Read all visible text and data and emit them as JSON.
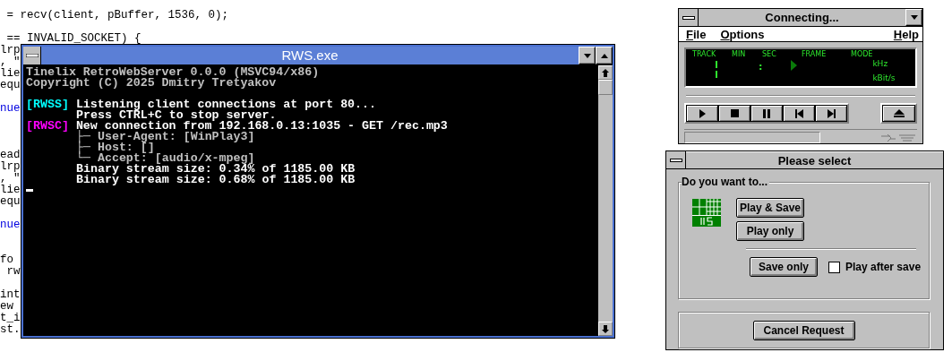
{
  "editor": {
    "lines": [
      {
        "kind": "code",
        "text": " = recv(client, pBuffer, 1536, 0);"
      },
      {
        "kind": "blank"
      },
      {
        "kind": "code",
        "text": " == INVALID_SOCKET) {"
      },
      {
        "kind": "code",
        "text": "lrp"
      },
      {
        "kind": "code",
        "text": ", \""
      },
      {
        "kind": "code",
        "text": "lie"
      },
      {
        "kind": "code",
        "text": "equ"
      },
      {
        "kind": "blank"
      },
      {
        "kind": "keyword",
        "text": "nue"
      },
      {
        "kind": "blank"
      },
      {
        "kind": "blank"
      },
      {
        "kind": "blank"
      },
      {
        "kind": "code",
        "text": "ead"
      },
      {
        "kind": "code",
        "text": "lrp"
      },
      {
        "kind": "code",
        "text": ", \""
      },
      {
        "kind": "code",
        "text": "lie"
      },
      {
        "kind": "code",
        "text": "equ"
      },
      {
        "kind": "blank"
      },
      {
        "kind": "keyword",
        "text": "nue"
      },
      {
        "kind": "blank"
      },
      {
        "kind": "blank"
      },
      {
        "kind": "code",
        "text": "fo"
      },
      {
        "kind": "code",
        "text": " rw"
      },
      {
        "kind": "blank"
      },
      {
        "kind": "code",
        "text": "int"
      },
      {
        "kind": "code",
        "text": "ew"
      },
      {
        "kind": "code",
        "text": "t_i"
      },
      {
        "kind": "code",
        "text": "st."
      }
    ]
  },
  "console": {
    "title": "RWS.exe",
    "lines": [
      {
        "kind": "header",
        "text": "Tinelix RetroWebServer 0.0.0 (MSVC94/x86)"
      },
      {
        "kind": "header",
        "text": "Copyright (C) 2025 Dmitry Tretyakov"
      },
      {
        "kind": "blank"
      },
      {
        "kind": "tagged",
        "tag": "[RWSS]",
        "color": "#00ffff",
        "text": "Listening client connections at port 80..."
      },
      {
        "kind": "continued",
        "text": "Press CTRL+C to stop server."
      },
      {
        "kind": "tagged",
        "tag": "[RWSC]",
        "color": "#ff00ff",
        "text": "New connection from 192.168.0.13:1035 - GET /rec.mp3"
      },
      {
        "kind": "detail",
        "text": "├─ User-Agent: [WinPlay3]"
      },
      {
        "kind": "detail",
        "text": "├─ Host: []"
      },
      {
        "kind": "detail",
        "text": "└─ Accept: [audio/x-mpeg]"
      },
      {
        "kind": "continued",
        "text": "Binary stream size: 0.34% of 1185.00 KB"
      },
      {
        "kind": "continued",
        "text": "Binary stream size: 0.68% of 1185.00 KB"
      }
    ]
  },
  "player": {
    "title": "Connecting...",
    "menu": [
      {
        "label": "File"
      },
      {
        "label": "Options"
      },
      {
        "label": "Help"
      }
    ],
    "display": {
      "labels": [
        "TRACK",
        "MIN",
        "SEC",
        "FRAME",
        "MODE"
      ],
      "separator": ":",
      "units": [
        "kHz",
        "kBit/s"
      ]
    },
    "transport": [
      {
        "kind": "play"
      },
      {
        "kind": "stop"
      },
      {
        "kind": "pause"
      },
      {
        "kind": "previous"
      },
      {
        "kind": "next"
      }
    ],
    "eject": {
      "kind": "eject"
    }
  },
  "dialog": {
    "title": "Please select",
    "group_label": "Do you want to...",
    "choices": [
      {
        "label": "Play & Save"
      },
      {
        "label": "Play only"
      }
    ],
    "save_choice": {
      "label": "Save only"
    },
    "checkbox": {
      "label": "Play after save",
      "checked": false
    },
    "cancel": {
      "label": "Cancel Request"
    }
  }
}
